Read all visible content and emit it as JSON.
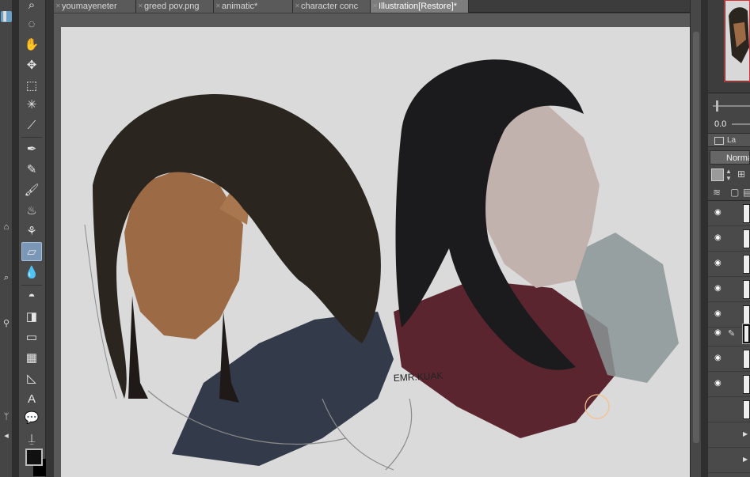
{
  "tabs": [
    {
      "label": "youmayeneter"
    },
    {
      "label": "greed pov.png"
    },
    {
      "label": "animatic*"
    },
    {
      "label": "character conc"
    },
    {
      "label": "Illustration[Restore]*"
    }
  ],
  "active_tab_index": 4,
  "tools": [
    {
      "icon": "magnify-icon"
    },
    {
      "icon": "lasso-rotate-icon"
    },
    {
      "icon": "move-hand-icon"
    },
    {
      "icon": "transform-icon"
    },
    {
      "icon": "marquee-icon"
    },
    {
      "icon": "magic-wand-icon"
    },
    {
      "icon": "eyedropper-icon"
    },
    {
      "icon": "pen-icon"
    },
    {
      "icon": "pencil-icon"
    },
    {
      "icon": "brush-icon"
    },
    {
      "icon": "airbrush-icon"
    },
    {
      "icon": "decoration-icon"
    },
    {
      "icon": "eraser-icon"
    },
    {
      "icon": "blend-icon"
    },
    {
      "icon": "fill-icon"
    },
    {
      "icon": "gradient-icon"
    },
    {
      "icon": "figure-icon"
    },
    {
      "icon": "frame-icon"
    },
    {
      "icon": "ruler-icon"
    },
    {
      "icon": "text-icon"
    },
    {
      "icon": "balloon-icon"
    },
    {
      "icon": "correct-line-icon"
    }
  ],
  "active_tool": "eraser-icon",
  "canvas": {
    "signature": "EMR.KUAK",
    "background_color": "#dadada"
  },
  "right_panel": {
    "zoom_value": "0.0",
    "layer_tab_label": "La",
    "blend_mode": "Norma"
  },
  "colors": {
    "accent": "#7b97b8",
    "navigator_frame": "#dd3333",
    "foreground_color": "#111111",
    "background_color": "#000000"
  }
}
